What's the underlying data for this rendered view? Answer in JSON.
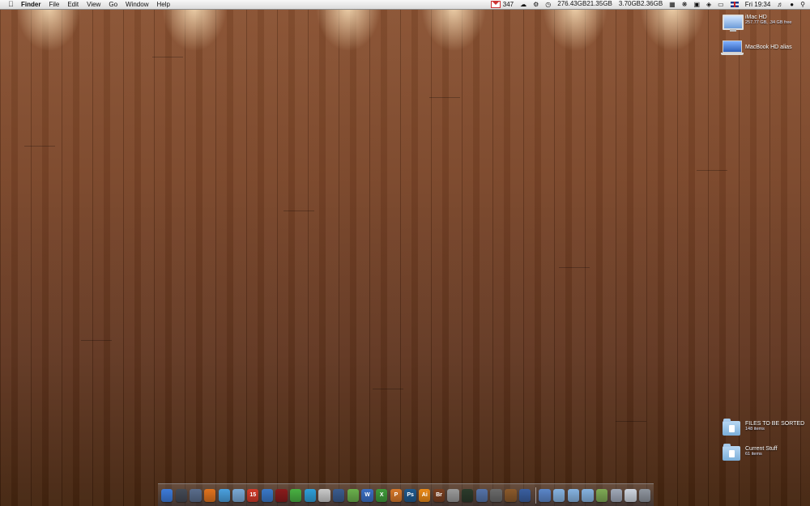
{
  "menubar": {
    "app_name": "Finder",
    "menus": [
      "File",
      "Edit",
      "View",
      "Go",
      "Window",
      "Help"
    ],
    "gmail_count": "347",
    "disk_stats_a": [
      "276.43GB",
      "21.35GB"
    ],
    "disk_stats_b": [
      "3.70GB",
      "2.36GB"
    ],
    "clock": "Fri 19:34"
  },
  "desktop": {
    "drives": [
      {
        "label": "iMac HD",
        "sub": "257.77 GB, .34 GB free",
        "icon": "imac-icon"
      },
      {
        "label": "MacBook HD alias",
        "sub": "",
        "icon": "macbook-icon"
      }
    ],
    "folders": [
      {
        "label": "FILES TO BE SORTED",
        "sub": "148 items",
        "icon": "folder-icon"
      },
      {
        "label": "Current Stuff",
        "sub": "61 items",
        "icon": "folder-icon"
      }
    ]
  },
  "dock": {
    "apps": [
      {
        "icon": "finder-icon",
        "text": "",
        "color": "#3d7bd9"
      },
      {
        "icon": "dashboard-icon",
        "text": "",
        "color": "#444a55"
      },
      {
        "icon": "spaces-icon",
        "text": "",
        "color": "#5a6d8c"
      },
      {
        "icon": "firefox-icon",
        "text": "",
        "color": "#e0731e"
      },
      {
        "icon": "safari-icon",
        "text": "",
        "color": "#4aa0de"
      },
      {
        "icon": "mail-icon",
        "text": "",
        "color": "#7aa9d6"
      },
      {
        "icon": "calendar-icon",
        "text": "15",
        "color": "#d23a2a"
      },
      {
        "icon": "itunes-icon",
        "text": "",
        "color": "#3a78c8"
      },
      {
        "icon": "photo-booth-icon",
        "text": "",
        "color": "#8a1c1c"
      },
      {
        "icon": "facetime-icon",
        "text": "",
        "color": "#49b042"
      },
      {
        "icon": "messenger-icon",
        "text": "",
        "color": "#2f9fd8"
      },
      {
        "icon": "script-editor-icon",
        "text": "",
        "color": "#c9c9c9"
      },
      {
        "icon": "preview-icon",
        "text": "",
        "color": "#3b5c8e"
      },
      {
        "icon": "plant-icon",
        "text": "",
        "color": "#6ab04c"
      },
      {
        "icon": "word-icon",
        "text": "W",
        "color": "#3b6fc4"
      },
      {
        "icon": "excel-icon",
        "text": "X",
        "color": "#3f9b3a"
      },
      {
        "icon": "powerpoint-icon",
        "text": "P",
        "color": "#d7782a"
      },
      {
        "icon": "photoshop-icon",
        "text": "Ps",
        "color": "#1f5a8e"
      },
      {
        "icon": "illustrator-icon",
        "text": "Ai",
        "color": "#ec8a17"
      },
      {
        "icon": "bridge-icon",
        "text": "Br",
        "color": "#7a3f20"
      },
      {
        "icon": "system-preferences-icon",
        "text": "",
        "color": "#9a9a9a"
      },
      {
        "icon": "activity-monitor-icon",
        "text": "",
        "color": "#2b3b2b"
      },
      {
        "icon": "imovie-icon",
        "text": "",
        "color": "#5573a8"
      },
      {
        "icon": "utilities-icon",
        "text": "",
        "color": "#6a6a6a"
      },
      {
        "icon": "coffee-icon",
        "text": "",
        "color": "#8b5a2b"
      },
      {
        "icon": "xcode-icon",
        "text": "",
        "color": "#3a5fa0"
      }
    ],
    "stacks": [
      {
        "icon": "monitor-icon",
        "text": "",
        "color": "#5b86c9"
      },
      {
        "icon": "folder-icon",
        "text": "",
        "color": "#86b3e0"
      },
      {
        "icon": "folder-icon",
        "text": "",
        "color": "#86b3e0"
      },
      {
        "icon": "folder-icon",
        "text": "",
        "color": "#86b3e0"
      },
      {
        "icon": "documents-icon",
        "text": "",
        "color": "#7faa55"
      },
      {
        "icon": "downloads-icon",
        "text": "",
        "color": "#a0a8b8"
      },
      {
        "icon": "screen-icon",
        "text": "",
        "color": "#cfd6e0"
      },
      {
        "icon": "trash-icon",
        "text": "",
        "color": "#8f959e"
      }
    ]
  }
}
